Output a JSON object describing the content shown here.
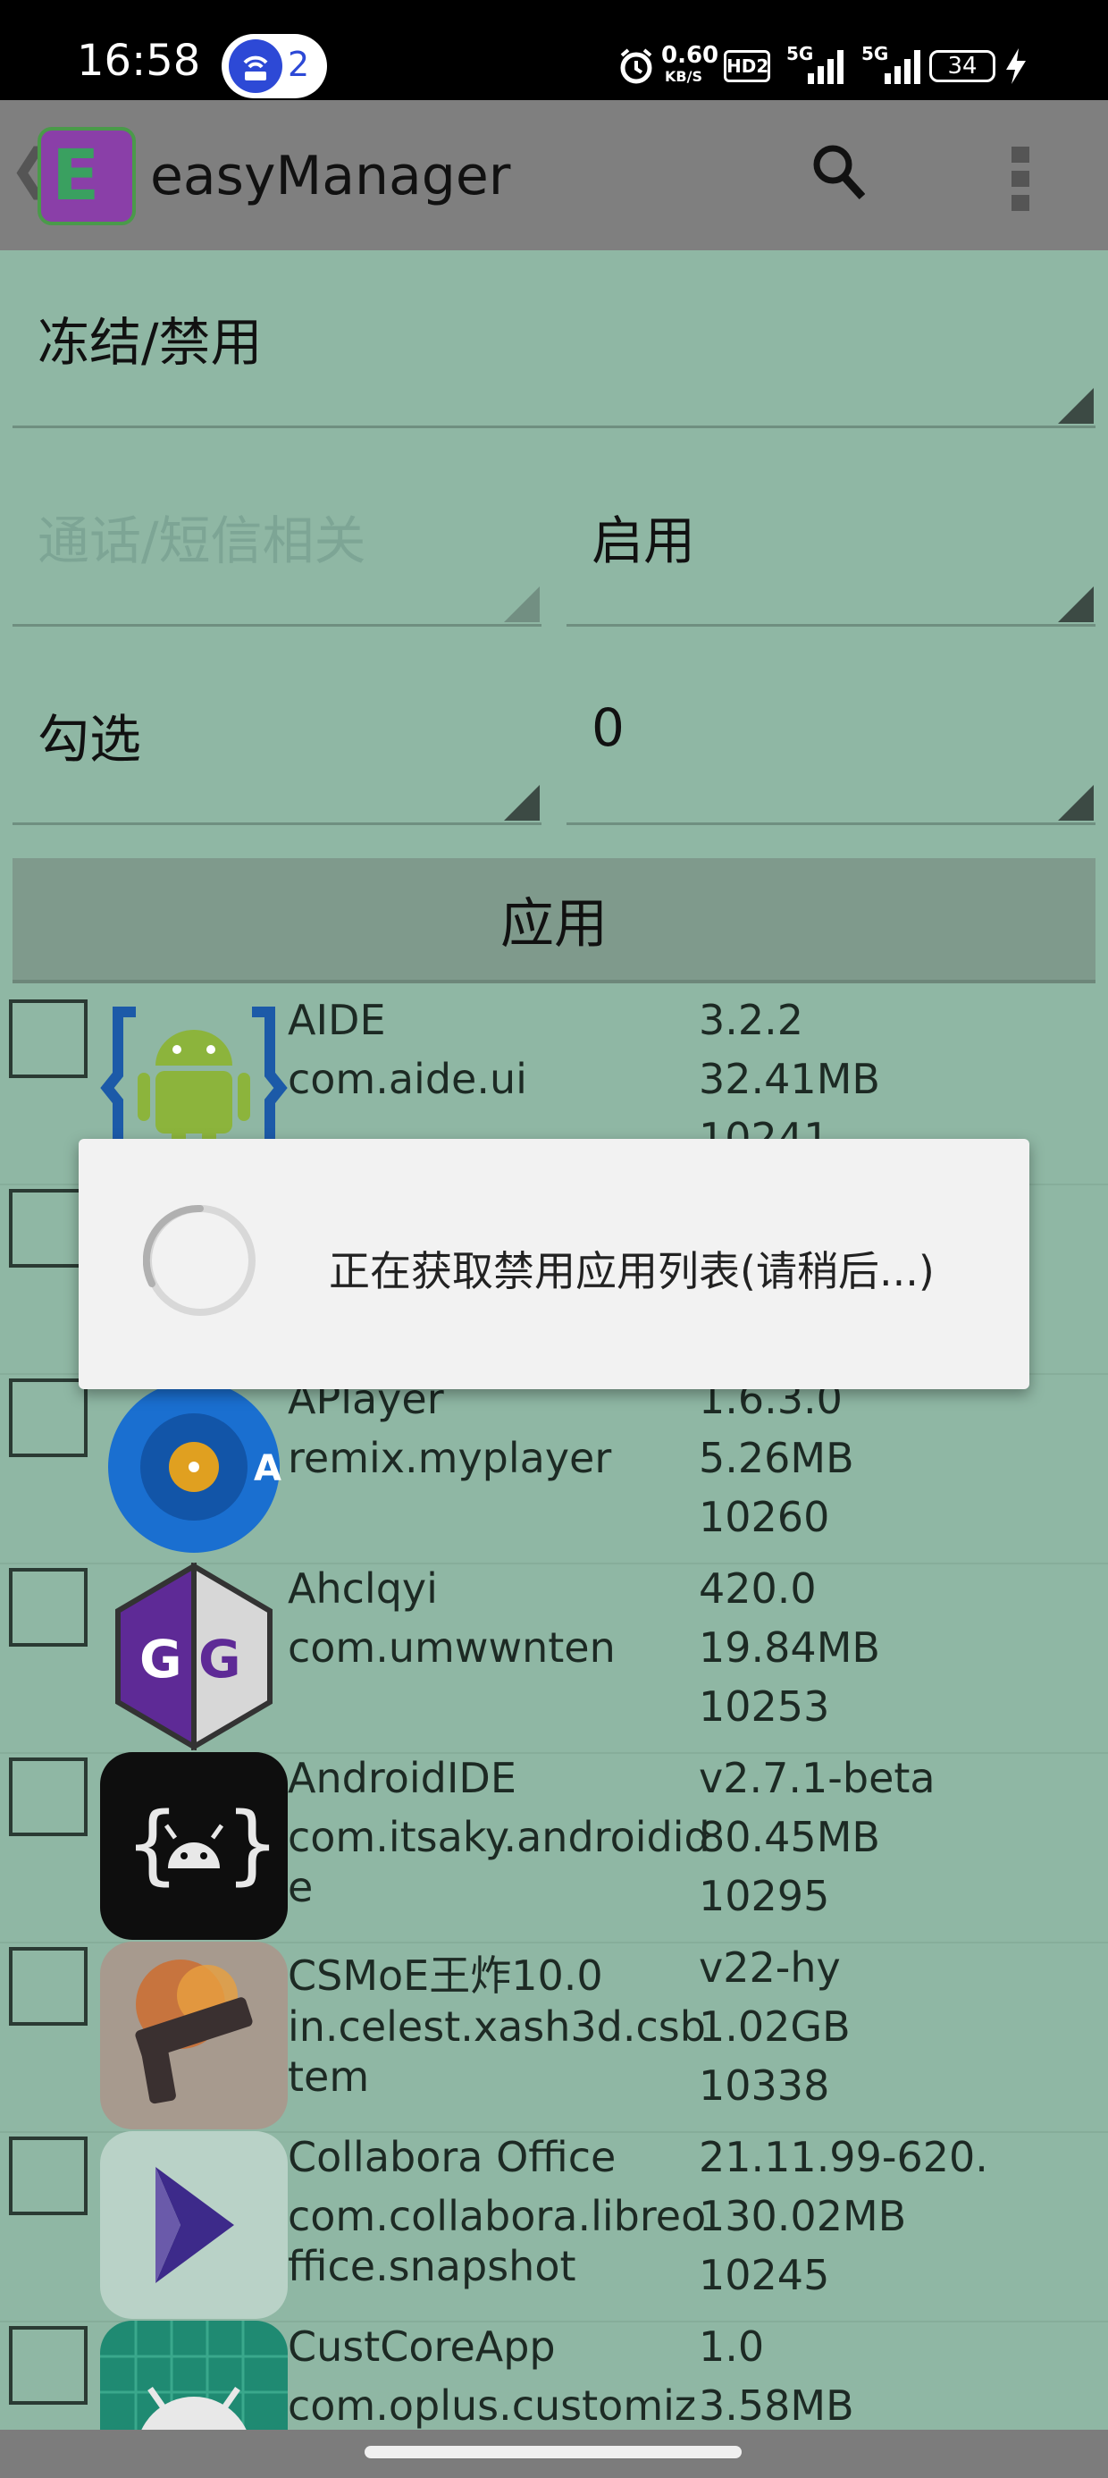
{
  "status_bar": {
    "time": "16:58",
    "notification_count": "2",
    "net_speed_value": "0.60",
    "net_speed_unit": "KB/S",
    "hd_label": "HD2",
    "signal1_label": "5G",
    "signal2_label": "5G",
    "battery": "34"
  },
  "toolbar": {
    "back_glyph": "❮",
    "logo_letter": "E",
    "title": "easyManager"
  },
  "filters": {
    "mode": "冻结/禁用",
    "category_placeholder": "通话/短信相关",
    "action": "启用",
    "select_label": "勾选",
    "select_count": "0",
    "apply_label": "应用"
  },
  "apps": [
    {
      "name": "AIDE",
      "pkg": "com.aide.ui",
      "pkg2": "",
      "version": "3.2.2",
      "size": "32.41MB",
      "uid": "10241",
      "icon": "android-braces-icon",
      "icon_color": "#7fb23f"
    },
    {
      "name": "",
      "pkg": "",
      "pkg2": "",
      "version": "",
      "size": "",
      "uid": "",
      "icon": "hidden-app-icon",
      "icon_color": "#8fb7a4"
    },
    {
      "name": "APlayer",
      "pkg": "remix.myplayer",
      "pkg2": "",
      "version": "1.6.3.0",
      "size": "5.26MB",
      "uid": "10260",
      "icon": "aplayer-disc-icon",
      "icon_color": "#1a6fd0"
    },
    {
      "name": "Ahclqyi",
      "pkg": "com.umwwnten",
      "pkg2": "",
      "version": "420.0",
      "size": "19.84MB",
      "uid": "10253",
      "icon": "gg-shield-icon",
      "icon_color": "#5a2a8f"
    },
    {
      "name": "AndroidIDE",
      "pkg": "com.itsaky.androidid",
      "pkg2": "e",
      "version": "v2.7.1-beta",
      "size": "80.45MB",
      "uid": "10295",
      "icon": "androidide-icon",
      "icon_color": "#111111"
    },
    {
      "name": "CSMoE王炸10.0",
      "pkg": "in.celest.xash3d.csb",
      "pkg2": "tem",
      "version": "v22-hy",
      "size": "1.02GB",
      "uid": "10338",
      "icon": "gun-explosion-icon",
      "icon_color": "#8c7a6a"
    },
    {
      "name": "Collabora Office",
      "pkg": "com.collabora.libreo",
      "pkg2": "ffice.snapshot",
      "version": "21.11.99-620.",
      "size": "130.02MB",
      "uid": "10245",
      "icon": "collabora-arrow-icon",
      "icon_color": "#3d2a8a"
    },
    {
      "name": "CustCoreApp",
      "pkg": "com.oplus.customiz",
      "pkg2": "",
      "version": "1.0",
      "size": "3.58MB",
      "uid": "",
      "icon": "android-grid-icon",
      "icon_color": "#1f9a80"
    }
  ],
  "dialog": {
    "message": "正在获取禁用应用列表(请稍后...)"
  }
}
